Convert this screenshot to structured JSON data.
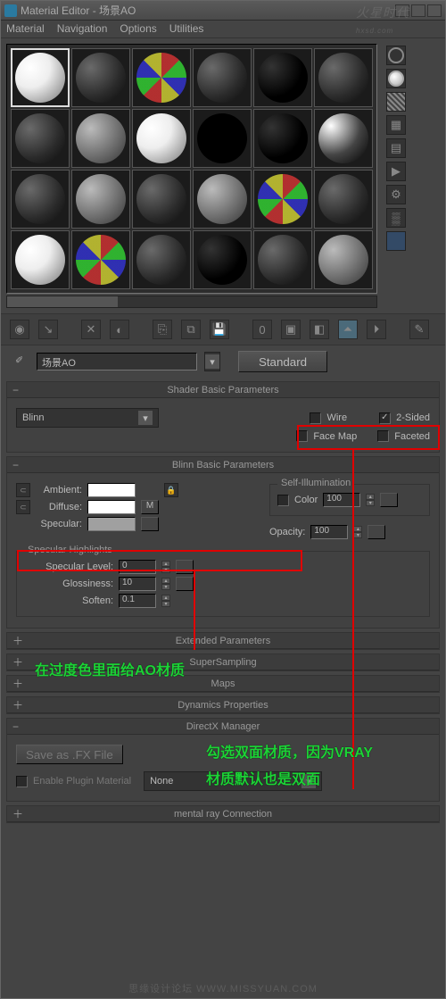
{
  "window": {
    "title": "Material Editor - 场景AO"
  },
  "watermark_top": "火星时代",
  "watermark_top_sub": "hxsd.com",
  "watermark_bottom": "思缘设计论坛   WWW.MISSYUAN.COM",
  "menu": {
    "material": "Material",
    "navigation": "Navigation",
    "options": "Options",
    "utilities": "Utilities"
  },
  "name_field": "场景AO",
  "material_type_button": "Standard",
  "rollup_shader_basic": "Shader Basic Parameters",
  "shader_combo": "Blinn",
  "checks": {
    "wire": "Wire",
    "twosided": "2-Sided",
    "facemap": "Face Map",
    "faceted": "Faceted"
  },
  "rollup_blinn_basic": "Blinn Basic Parameters",
  "selfillum_group": "Self-Illumination",
  "labels": {
    "ambient": "Ambient:",
    "diffuse": "Diffuse:",
    "specular": "Specular:",
    "color": "Color",
    "opacity": "Opacity:",
    "spechigh": "Specular Highlights",
    "speclevel": "Specular Level:",
    "gloss": "Glossiness:",
    "soften": "Soften:"
  },
  "values": {
    "color": "100",
    "opacity": "100",
    "speclevel": "0",
    "gloss": "10",
    "soften": "0.1"
  },
  "diffuse_map_btn": "M",
  "rollups": {
    "ext": "Extended Parameters",
    "ss": "SuperSampling",
    "maps": "Maps",
    "dyn": "Dynamics Properties",
    "dx": "DirectX Manager",
    "mr": "mental ray Connection"
  },
  "dx": {
    "save_btn": "Save as .FX File",
    "enable": "Enable Plugin Material",
    "plugin": "None"
  },
  "annotations": {
    "diffuse": "在过度色里面给AO材质",
    "twosided_l1": "勾选双面材质，因为VRAY",
    "twosided_l2": "材质默认也是双面"
  }
}
